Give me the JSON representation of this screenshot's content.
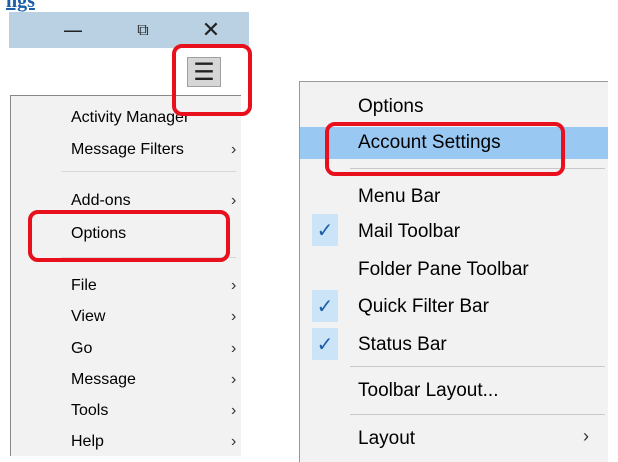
{
  "link_fragment": "ngs",
  "titlebar": {
    "minimize_glyph": "—",
    "restore_glyph": "⧉",
    "close_glyph": "✕"
  },
  "menu_button": {
    "glyph": "☰"
  },
  "left_menu": {
    "items": [
      {
        "label": "Activity Manager",
        "has_submenu": false
      },
      {
        "label": "Message Filters",
        "has_submenu": true
      },
      {
        "label": "Add-ons",
        "has_submenu": true
      },
      {
        "label": "Options",
        "has_submenu": false
      },
      {
        "label": "File",
        "has_submenu": true
      },
      {
        "label": "View",
        "has_submenu": true
      },
      {
        "label": "Go",
        "has_submenu": true
      },
      {
        "label": "Message",
        "has_submenu": true
      },
      {
        "label": "Tools",
        "has_submenu": true
      },
      {
        "label": "Help",
        "has_submenu": true
      }
    ],
    "arrow_glyph": "›"
  },
  "right_menu": {
    "items": [
      {
        "label": "Options",
        "checked": false
      },
      {
        "label": "Account Settings",
        "checked": false,
        "highlighted": true
      },
      {
        "label": "Menu Bar",
        "checked": false
      },
      {
        "label": "Mail Toolbar",
        "checked": true
      },
      {
        "label": "Folder Pane Toolbar",
        "checked": false
      },
      {
        "label": "Quick Filter Bar",
        "checked": true
      },
      {
        "label": "Status Bar",
        "checked": true
      },
      {
        "label": "Toolbar Layout...",
        "checked": false
      },
      {
        "label": "Layout",
        "checked": false,
        "has_submenu": true
      }
    ],
    "check_glyph": "✓",
    "arrow_glyph": "›"
  },
  "colors": {
    "titlebar": "#b9d1e2",
    "highlight": "#99c9f3",
    "check_bg": "#cce4f7",
    "annotation_red": "#e8101c",
    "link": "#1a5fa8"
  }
}
